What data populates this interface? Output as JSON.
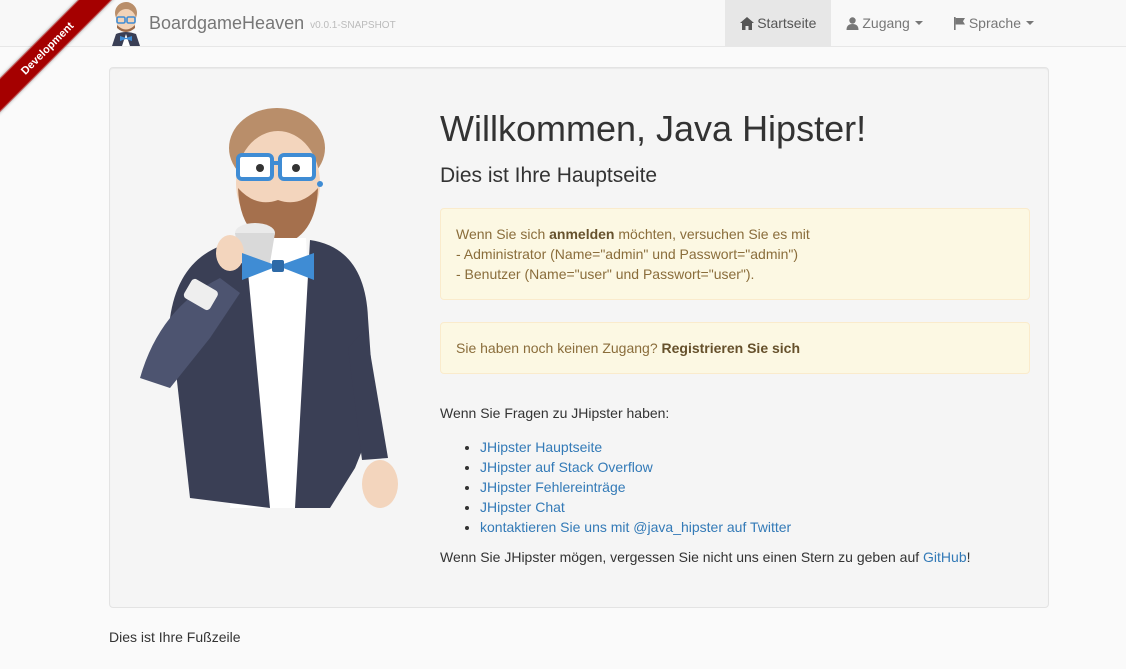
{
  "ribbon": {
    "label": "Development",
    "color": "#a50000"
  },
  "navbar": {
    "brand_title": "BoardgameHeaven",
    "brand_version": "v0.0.1-SNAPSHOT",
    "items": [
      {
        "label": "Startseite",
        "icon": "home-icon",
        "active": true
      },
      {
        "label": "Zugang",
        "icon": "user-icon",
        "dropdown": true
      },
      {
        "label": "Sprache",
        "icon": "flag-icon",
        "dropdown": true
      }
    ]
  },
  "main": {
    "title": "Willkommen, Java Hipster!",
    "subtitle": "Dies ist Ihre Hauptseite",
    "login_alert": {
      "prefix": "Wenn Sie sich ",
      "link": "anmelden",
      "suffix": " möchten, versuchen Sie es mit",
      "line2": "- Administrator (Name=\"admin\" und Passwort=\"admin\")",
      "line3": "- Benutzer (Name=\"user\" und Passwort=\"user\")."
    },
    "register_alert": {
      "prefix": "Sie haben noch keinen Zugang? ",
      "link": "Registrieren Sie sich"
    },
    "questions_text": "Wenn Sie Fragen zu JHipster haben:",
    "links": [
      "JHipster Hauptseite",
      "JHipster auf Stack Overflow",
      "JHipster Fehlereinträge",
      "JHipster Chat",
      "kontaktieren Sie uns mit @java_hipster auf Twitter"
    ],
    "star_prefix": "Wenn Sie JHipster mögen, vergessen Sie nicht uns einen Stern zu geben auf ",
    "star_link": "GitHub",
    "star_suffix": "!"
  },
  "footer": {
    "text": "Dies ist Ihre Fußzeile"
  },
  "colors": {
    "link": "#337ab7",
    "alert_bg": "#fcf8e3",
    "alert_text": "#8a6d3b"
  }
}
